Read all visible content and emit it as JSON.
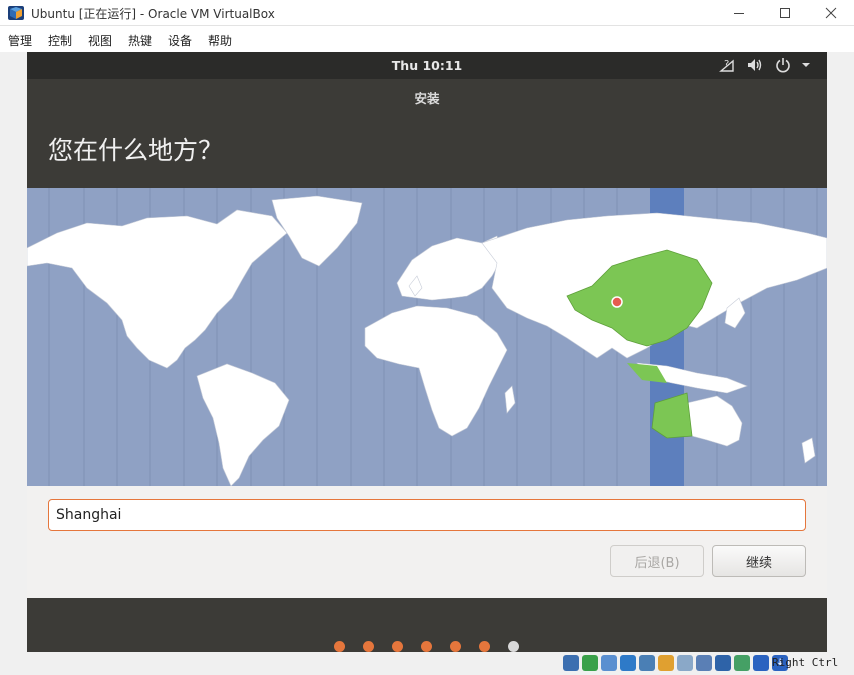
{
  "window": {
    "title": "Ubuntu [正在运行] - Oracle VM VirtualBox",
    "icon": "virtualbox-icon"
  },
  "menubar": {
    "items": [
      "管理",
      "控制",
      "视图",
      "热键",
      "设备",
      "帮助"
    ]
  },
  "guest": {
    "topbar": {
      "clock": "Thu 10:11",
      "tray_icons": [
        "accessibility-icon",
        "volume-icon",
        "power-icon",
        "chevron-down-icon"
      ]
    },
    "installer": {
      "title": "安装",
      "heading": "您在什么地方？",
      "map": {
        "selected_region": "China",
        "highlight_color": "#7cc654",
        "ocean_color": "#8fa1c4",
        "timezone_band_color": "#5d7fbd"
      },
      "location_input": {
        "value": "Shanghai"
      },
      "buttons": {
        "back": "后退(B)",
        "continue": "继续"
      },
      "progress": {
        "total_steps": 7,
        "current_step": 7
      }
    }
  },
  "statusbar": {
    "icons": [
      "hard-disk-icon",
      "optical-drive-icon",
      "audio-icon",
      "network-icon",
      "usb-icon",
      "shared-folders-icon",
      "display-icon",
      "video-capture-icon",
      "cpu-icon",
      "mouse-integration-icon",
      "keyboard-icon",
      "arrow-down-icon"
    ],
    "host_key": "Right Ctrl"
  },
  "colors": {
    "accent": "#e5763c",
    "header_bg": "#3c3b37",
    "topbar_bg": "#2b2b29"
  }
}
